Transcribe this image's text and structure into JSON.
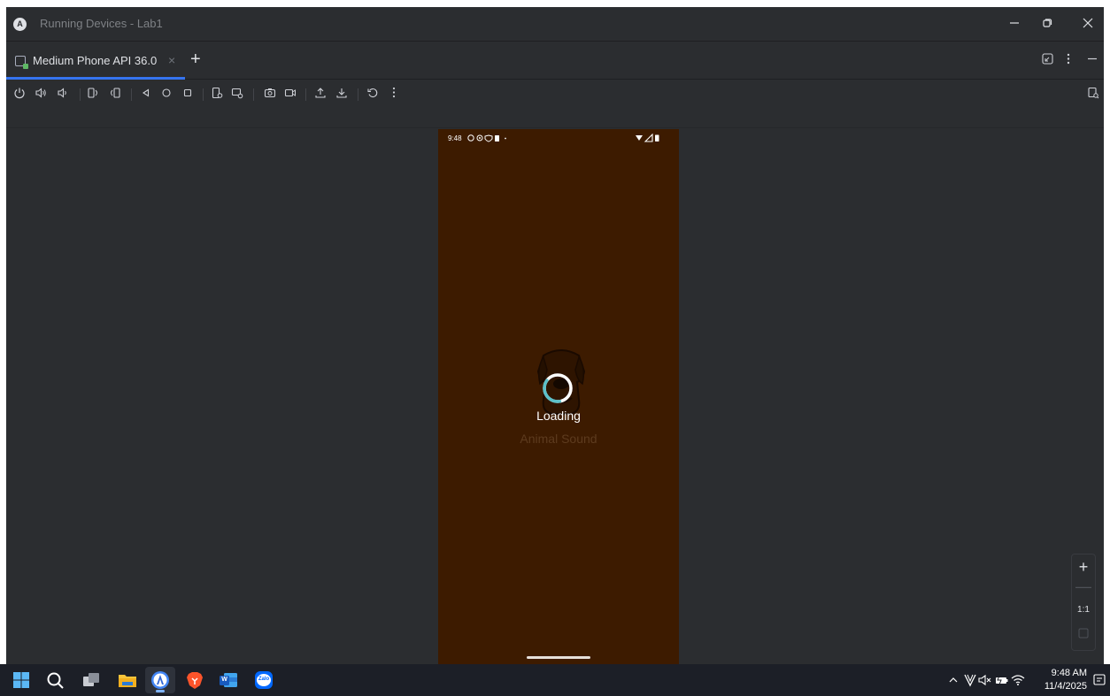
{
  "window": {
    "title": "Running Devices - Lab1",
    "minimize_icon": "minimize-icon",
    "restore_icon": "restore-icon",
    "close_icon": "close-icon"
  },
  "tabs": [
    {
      "label": "Medium Phone API 36.0",
      "active": true
    }
  ],
  "toolbar": {
    "icons": [
      "power-icon",
      "volume-up-icon",
      "volume-down-icon",
      "rotate-left-icon",
      "rotate-right-icon",
      "back-icon",
      "home-icon",
      "overview-icon",
      "device-manager-icon",
      "snapshot-icon",
      "screenshot-icon",
      "screen-record-icon",
      "upload-icon",
      "download-icon",
      "reset-icon",
      "more-icon"
    ]
  },
  "device": {
    "status_time": "9:48",
    "loading_label": "Loading",
    "app_name": "Animal Sound",
    "background_color": "#3d1b00",
    "spinner_color": "#5bc0c9"
  },
  "zoom": {
    "actual_size_label": "1:1"
  },
  "taskbar": {
    "apps": [
      "windows-start-icon",
      "search-icon",
      "task-view-icon",
      "file-explorer-icon",
      "android-studio-icon",
      "brave-browser-icon",
      "word-icon",
      "zalo-icon"
    ],
    "zalo_label": "Zalo",
    "word_label": "W",
    "time": "9:48 AM",
    "date": "11/4/2025"
  }
}
